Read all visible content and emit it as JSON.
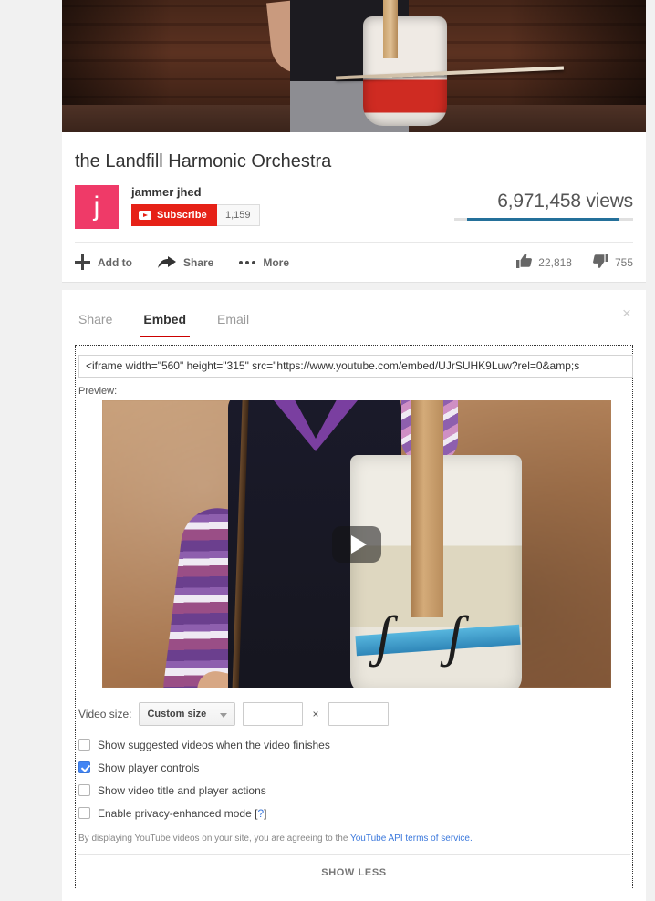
{
  "video": {
    "title": "the Landfill Harmonic Orchestra",
    "channel_name": "jammer jhed",
    "avatar_letter": "j",
    "avatar_color": "#ef3a68",
    "subscribe_label": "Subscribe",
    "subscriber_count": "1,159",
    "views_text": "6,971,458 views",
    "likes": "22,818",
    "dislikes": "755"
  },
  "actions": [
    {
      "label": "Add to",
      "icon": "plus-icon"
    },
    {
      "label": "Share",
      "icon": "share-arrow-icon"
    },
    {
      "label": "More",
      "icon": "more-dots-icon"
    }
  ],
  "panel": {
    "close_label": "×",
    "tabs": [
      {
        "label": "Share",
        "active": false
      },
      {
        "label": "Embed",
        "active": true
      },
      {
        "label": "Email",
        "active": false
      }
    ],
    "embed_code": "<iframe width=\"560\" height=\"315\" src=\"https://www.youtube.com/embed/UJrSUHK9Luw?rel=0&amp;s",
    "preview_label": "Preview:",
    "video_size": {
      "label": "Video size:",
      "selected_option": "Custom size",
      "options": [
        "Custom size"
      ],
      "width_value": "",
      "height_value": "",
      "separator": "×"
    },
    "options": [
      {
        "label": "Show suggested videos when the video finishes",
        "checked": false
      },
      {
        "label": "Show player controls",
        "checked": true
      },
      {
        "label": "Show video title and player actions",
        "checked": false
      },
      {
        "label": "Enable privacy-enhanced mode [?]",
        "checked": false
      }
    ],
    "tos_prefix": "By displaying YouTube videos on your site, you are agreeing to the ",
    "tos_link": "YouTube API terms of service.",
    "show_less_label": "SHOW LESS"
  },
  "colors": {
    "brand_red": "#e62117",
    "active_tab_underline": "#cc0000",
    "views_bar": "#24709a",
    "link_blue": "#3b78dc",
    "checkbox_checked": "#4285f4"
  }
}
